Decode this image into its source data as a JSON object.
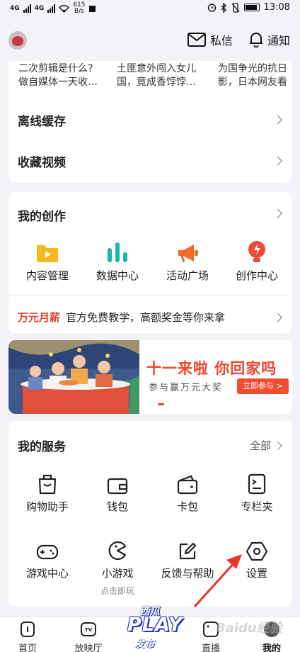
{
  "status_bar": {
    "signal1": "4G",
    "signal2": "4G",
    "speed_value": "615",
    "speed_unit": "B/s",
    "time": "13:08"
  },
  "header": {
    "messages_label": "私信",
    "notifications_label": "通知"
  },
  "video_titles": [
    "二次剪辑是什么?",
    "做自媒体一天收…",
    "土匪意外闯入女儿",
    "国，竟成香饽饽…",
    "为国争光的抗日",
    "影，日本网友看"
  ],
  "menu": {
    "offline_cache": "离线缓存",
    "favorites": "收藏视频"
  },
  "creation": {
    "title": "我的创作",
    "items": [
      "内容管理",
      "数据中心",
      "活动广场",
      "创作中心"
    ],
    "promo_highlight": "万元月薪",
    "promo_text": "官方免费教学，高额奖金等你来拿"
  },
  "banner": {
    "title": "十一来啦 你回家吗",
    "subtitle": "参与赢万元大奖",
    "button": "立即参与 >"
  },
  "services": {
    "title": "我的服务",
    "all_label": "全部",
    "items": [
      "购物助手",
      "钱包",
      "卡包",
      "专栏夹",
      "游戏中心",
      "小游戏",
      "反馈与帮助",
      "设置"
    ],
    "mini_game_sub": "点击即玩"
  },
  "bottom_nav": {
    "tabs": [
      "首页",
      "放映厅",
      "直播",
      "我的"
    ],
    "logo_top": "西瓜",
    "logo_main": "PLAY",
    "logo_bottom": "发布"
  },
  "watermark": "Baidu经验",
  "colors": {
    "accent_red": "#e0402e",
    "icon_yellow": "#f7b81d",
    "icon_teal": "#1cb6a6",
    "icon_orange": "#f26a2b"
  }
}
